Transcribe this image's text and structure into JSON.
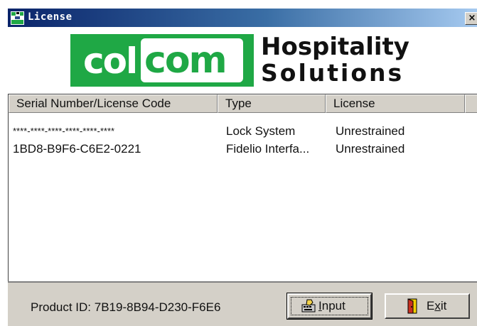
{
  "window": {
    "title": "License",
    "close_glyph": "×",
    "title_icon": "license-app-icon"
  },
  "banner": {
    "logo_part1": "col",
    "logo_part2": "com",
    "line1": "Hospitality",
    "line2": "Solutions",
    "brand_green": "#1fa845"
  },
  "table": {
    "columns": [
      "Serial Number/License Code",
      "Type",
      "License"
    ],
    "rows": [
      {
        "serial": "****-****-****-****-****-****",
        "type": "Lock System",
        "license": "Unrestrained"
      },
      {
        "serial": "1BD8-B9F6-C6E2-0221",
        "type": "Fidelio Interfa...",
        "license": "Unrestrained"
      }
    ]
  },
  "footer": {
    "product_id": "Product ID: 7B19-8B94-D230-F6E6",
    "input_button": {
      "mnemonic": "I",
      "rest": "nput",
      "icon": "keyboard-hand-icon"
    },
    "exit_button": {
      "prefix": "E",
      "mnemonic": "x",
      "rest": "it",
      "icon": "exit-door-icon"
    }
  }
}
